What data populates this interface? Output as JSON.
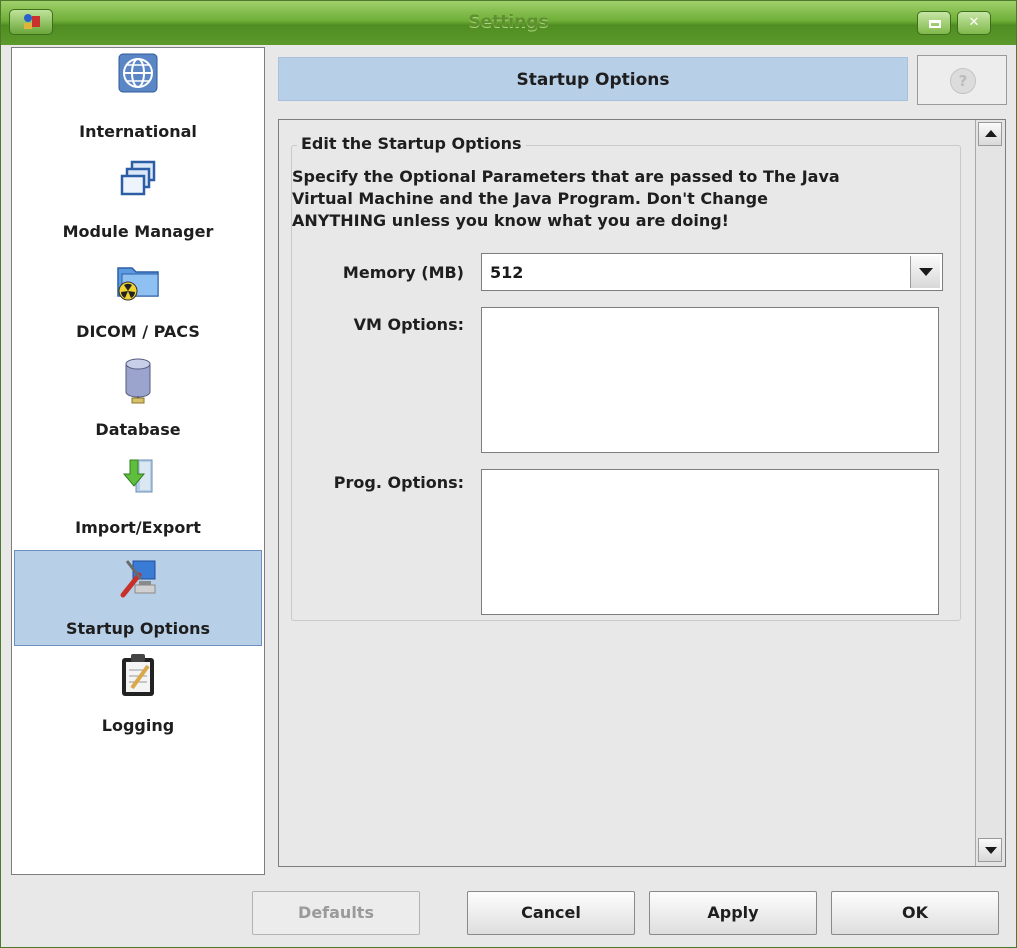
{
  "window": {
    "title": "Settings"
  },
  "sidebar": {
    "items": [
      {
        "label": "International",
        "icon": "globe-icon",
        "selected": false
      },
      {
        "label": "Module Manager",
        "icon": "windows-stack-icon",
        "selected": false
      },
      {
        "label": "DICOM / PACS",
        "icon": "radioactive-folder-icon",
        "selected": false
      },
      {
        "label": "Database",
        "icon": "database-icon",
        "selected": false
      },
      {
        "label": "Import/Export",
        "icon": "import-export-icon",
        "selected": false
      },
      {
        "label": "Startup Options",
        "icon": "startup-tools-icon",
        "selected": true
      },
      {
        "label": "Logging",
        "icon": "clipboard-icon",
        "selected": false
      }
    ]
  },
  "header": {
    "title": "Startup Options",
    "help_glyph": "?"
  },
  "panel": {
    "group_title": "Edit the Startup Options",
    "description_lines": [
      "Specify the Optional Parameters that are passed to The Java",
      "Virtual Machine and the Java Program. Don't Change",
      "ANYTHING unless you know what you are doing!"
    ],
    "memory_label": "Memory (MB)",
    "memory_value": "512",
    "vm_label": "VM Options:",
    "vm_value": "",
    "prog_label": "Prog. Options:",
    "prog_value": ""
  },
  "buttons": {
    "defaults": "Defaults",
    "cancel": "Cancel",
    "apply": "Apply",
    "ok": "OK"
  },
  "colors": {
    "titlebar": "#6fae38",
    "selection": "#b8cfe8"
  }
}
